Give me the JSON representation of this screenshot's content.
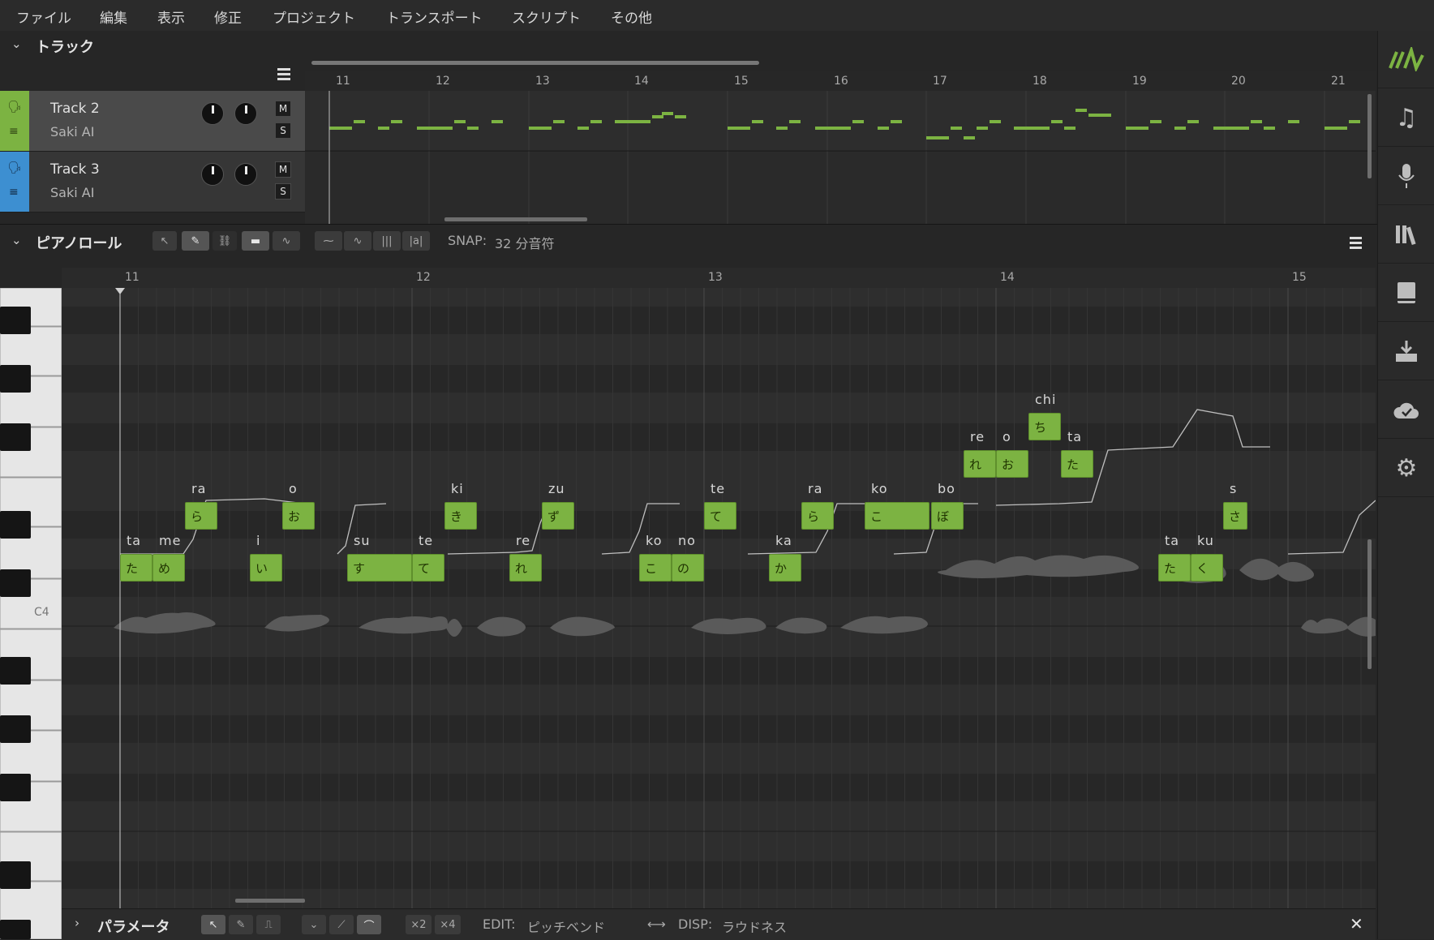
{
  "menu": [
    "ファイル",
    "編集",
    "表示",
    "修正",
    "プロジェクト",
    "トランスポート",
    "スクリプト",
    "その他"
  ],
  "tracks_panel": {
    "title": "トラック",
    "ruler": [
      "11",
      "12",
      "13",
      "14",
      "15",
      "16",
      "17",
      "18",
      "19",
      "20",
      "21"
    ],
    "tracks": [
      {
        "name": "Track 2",
        "singer": "Saki AI",
        "mute": "M",
        "solo": "S",
        "color": "#7cb342"
      },
      {
        "name": "Track 3",
        "singer": "Saki AI",
        "mute": "M",
        "solo": "S",
        "color": "#3d8fd1"
      }
    ]
  },
  "piano_roll": {
    "title": "ピアノロール",
    "snap_label": "SNAP:",
    "snap_value": "32 分音符",
    "ruler": [
      "11",
      "12",
      "13",
      "14",
      "15"
    ],
    "c4_label": "C4",
    "notes": [
      {
        "lyric": "ta",
        "kana": "た"
      },
      {
        "lyric": "me",
        "kana": "め"
      },
      {
        "lyric": "ra",
        "kana": "ら"
      },
      {
        "lyric": "i",
        "kana": "い"
      },
      {
        "lyric": "o",
        "kana": "お"
      },
      {
        "lyric": "su",
        "kana": "す"
      },
      {
        "lyric": "te",
        "kana": "て"
      },
      {
        "lyric": "ki",
        "kana": "き"
      },
      {
        "lyric": "re",
        "kana": "れ"
      },
      {
        "lyric": "zu",
        "kana": "ず"
      },
      {
        "lyric": "ko",
        "kana": "こ"
      },
      {
        "lyric": "no",
        "kana": "の"
      },
      {
        "lyric": "te",
        "kana": "て"
      },
      {
        "lyric": "ka",
        "kana": "か"
      },
      {
        "lyric": "ra",
        "kana": "ら"
      },
      {
        "lyric": "ko",
        "kana": "こ"
      },
      {
        "lyric": "bo",
        "kana": "ぼ"
      },
      {
        "lyric": "re",
        "kana": "れ"
      },
      {
        "lyric": "o",
        "kana": "お"
      },
      {
        "lyric": "chi",
        "kana": "ち"
      },
      {
        "lyric": "ta",
        "kana": "た"
      },
      {
        "lyric": "ta",
        "kana": "た"
      },
      {
        "lyric": "ku",
        "kana": "く"
      },
      {
        "lyric": "s",
        "kana": "さ"
      }
    ]
  },
  "param_panel": {
    "title": "パラメータ",
    "x2": "×2",
    "x4": "×4",
    "edit_label": "EDIT:",
    "edit_value": "ピッチベンド",
    "disp_label": "DISP:",
    "disp_value": "ラウドネス"
  },
  "toolbar_lyric_mode": "|a|",
  "colors": {
    "note": "#7cb342",
    "accent_green": "#7cb342",
    "track3": "#3d8fd1"
  }
}
